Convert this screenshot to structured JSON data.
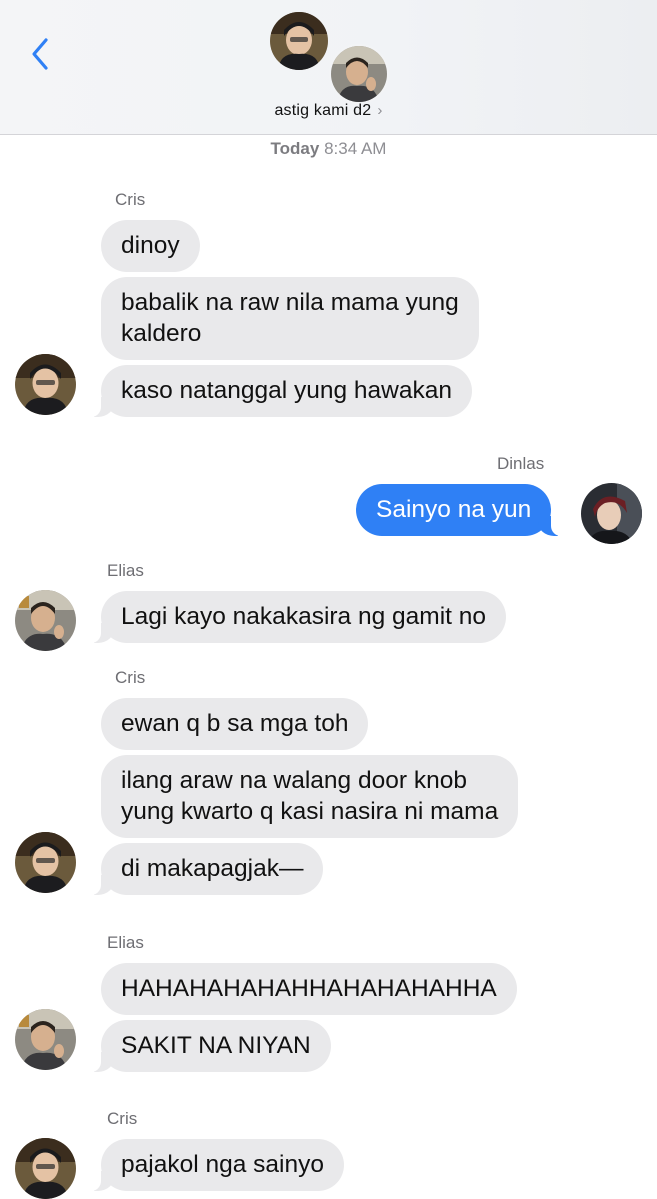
{
  "header": {
    "group_name": "astig kami d2",
    "chevron": "›",
    "back_icon": "chevron-left-icon",
    "accent_color": "#2f80f5"
  },
  "timestamp": {
    "day": "Today",
    "time": "8:34 AM"
  },
  "messages": [
    {
      "sender": "Cris",
      "texts": [
        "dinoy",
        "babalik na raw nila mama yung\nkaldero",
        "kaso natanggal yung hawakan"
      ]
    },
    {
      "sender": "Dinlas",
      "outgoing": true,
      "texts": [
        "Sainyo na yun"
      ]
    },
    {
      "sender": "Elias",
      "texts": [
        "Lagi kayo nakakasira ng gamit no"
      ]
    },
    {
      "sender": "Cris",
      "texts": [
        "ewan q b sa mga toh",
        "ilang araw na walang door knob\nyung kwarto q kasi nasira ni mama",
        "di makapagjak—"
      ]
    },
    {
      "sender": "Elias",
      "texts": [
        "HAHAHAHAHAHHAHAHAHAHHA",
        "SAKIT NA NIYAN"
      ]
    },
    {
      "sender": "Cris",
      "texts": [
        "pajakol nga sainyo"
      ]
    }
  ]
}
